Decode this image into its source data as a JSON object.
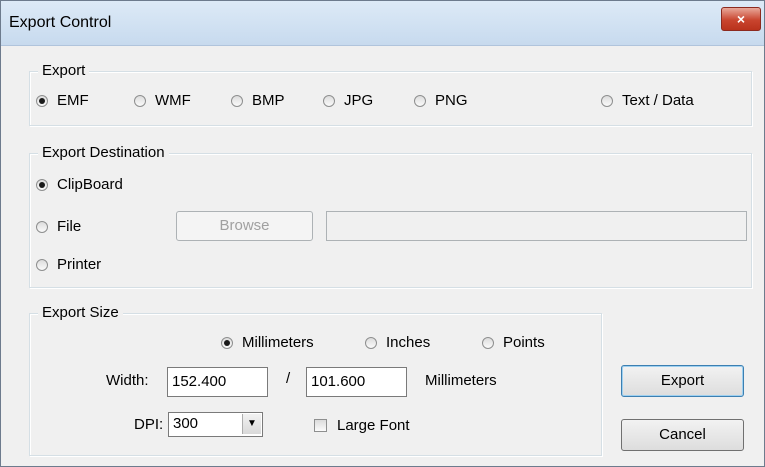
{
  "window": {
    "title": "Export Control",
    "close_label": "×"
  },
  "export": {
    "legend": "Export",
    "options": [
      {
        "label": "EMF",
        "selected": true
      },
      {
        "label": "WMF",
        "selected": false
      },
      {
        "label": "BMP",
        "selected": false
      },
      {
        "label": "JPG",
        "selected": false
      },
      {
        "label": "PNG",
        "selected": false
      },
      {
        "label": "Text / Data",
        "selected": false
      }
    ]
  },
  "destination": {
    "legend": "Export Destination",
    "options": [
      {
        "label": "ClipBoard",
        "selected": true
      },
      {
        "label": "File",
        "selected": false
      },
      {
        "label": "Printer",
        "selected": false
      }
    ],
    "browse_label": "Browse",
    "path_value": ""
  },
  "size": {
    "legend": "Export Size",
    "units": [
      {
        "label": "Millimeters",
        "selected": true
      },
      {
        "label": "Inches",
        "selected": false
      },
      {
        "label": "Points",
        "selected": false
      }
    ],
    "width_label": "Width:",
    "width_value": "152.400",
    "separator": "/",
    "height_value": "101.600",
    "unit_label": "Millimeters",
    "dpi_label": "DPI:",
    "dpi_value": "300",
    "large_font_label": "Large Font",
    "large_font_checked": false
  },
  "actions": {
    "export_label": "Export",
    "cancel_label": "Cancel"
  }
}
